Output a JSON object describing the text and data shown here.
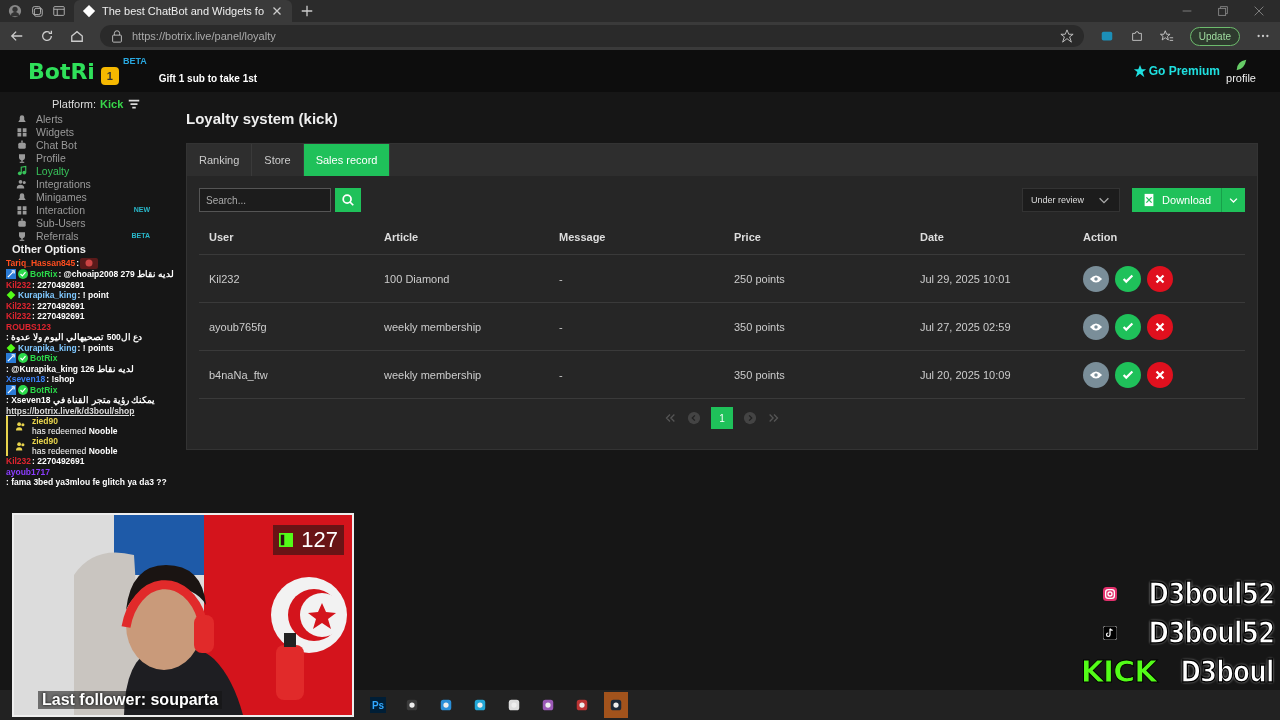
{
  "browser": {
    "tabs": [
      {
        "title": "The best ChatBot and Widgets fo",
        "selected": true
      }
    ],
    "url": "https://botrix.live/panel/loyalty",
    "update_button": "Update"
  },
  "header": {
    "logo": "BotRi",
    "logo_badge": "1",
    "beta": "BETA",
    "gift_text": "Gift 1 sub to take 1st",
    "premium": "Go Premium",
    "profile": "profile"
  },
  "sidebar": {
    "platform_label": "Platform:",
    "platform": "Kick",
    "items": [
      {
        "label": "Alerts",
        "selected": false
      },
      {
        "label": "Widgets",
        "selected": false
      },
      {
        "label": "Chat Bot",
        "selected": false
      },
      {
        "label": "Profile",
        "selected": false
      },
      {
        "label": "Loyalty",
        "selected": true
      },
      {
        "label": "Integrations",
        "selected": false
      },
      {
        "label": "Minigames",
        "selected": false
      },
      {
        "label": "Interaction",
        "selected": false,
        "badge": "NEW"
      },
      {
        "label": "Sub-Users",
        "selected": false
      },
      {
        "label": "Referrals",
        "selected": false,
        "badge": "BETA"
      }
    ],
    "section": "Other Options"
  },
  "chat_overlay": {
    "messages": [
      {
        "kind": "emote",
        "user": "Tariq_Hassan845",
        "color": "#ff4d1f",
        "text": ":"
      },
      {
        "kind": "bot",
        "user": "BotRix",
        "color": "#2bd94a",
        "text": ": @choaip2008 279 لديه نقاط"
      },
      {
        "kind": "plain",
        "user": "Kil232",
        "color": "#e0242f",
        "text": ": 2270492691"
      },
      {
        "kind": "sub",
        "user": "Kurapika_king",
        "color": "#7fc8ff",
        "text": ": ! point"
      },
      {
        "kind": "plain",
        "user": "Kil232",
        "color": "#e0242f",
        "text": ": 2270492691"
      },
      {
        "kind": "plain",
        "user": "Kil232",
        "color": "#e0242f",
        "text": ": 2270492691"
      },
      {
        "kind": "plain",
        "user": "ROUBS123",
        "color": "#e0242f",
        "text": ": دع ال500 تصحيهالي اليوم ولا عدوة"
      },
      {
        "kind": "sub",
        "user": "Kurapika_king",
        "color": "#7fc8ff",
        "text": ": ! points"
      },
      {
        "kind": "bot",
        "user": "BotRix",
        "color": "#2bd94a",
        "text": ": @Kurapika_king 126 لديه نقاط"
      },
      {
        "kind": "plain",
        "user": "Xseven18",
        "color": "#3b82f6",
        "text": ": !shop"
      },
      {
        "kind": "bot",
        "user": "BotRix",
        "color": "#2bd94a",
        "text": ": Xseven18 يمكنك رؤية متجر القناة في",
        "link": "https://botrix.live/k/d3boul/shop"
      },
      {
        "kind": "redeem",
        "user": "zied90",
        "color": "#e8d44d",
        "text": "has redeemed **Nooble**"
      },
      {
        "kind": "redeem",
        "user": "zied90",
        "color": "#e8d44d",
        "text": "has redeemed **Nooble**"
      },
      {
        "kind": "plain",
        "user": "Kil232",
        "color": "#e0242f",
        "text": ": 2270492691"
      },
      {
        "kind": "plain",
        "user": "ayoub1717",
        "color": "#8b3dff",
        "text": ": fama 3bed ya3mlou fe glitch ya da3 ??"
      }
    ]
  },
  "main": {
    "title": "Loyalty system (kick)",
    "tabs": [
      {
        "label": "Ranking",
        "selected": false
      },
      {
        "label": "Store",
        "selected": false
      },
      {
        "label": "Sales record",
        "selected": true
      }
    ],
    "search": {
      "placeholder": "Search..."
    },
    "filter": "Under review",
    "download": "Download",
    "table": {
      "columns": [
        "User",
        "Article",
        "Message",
        "Price",
        "Date",
        "Action"
      ],
      "rows": [
        {
          "user": "Kil232",
          "article": "100 Diamond",
          "message": "-",
          "price": "250 points",
          "date": "Jul 29, 2025 10:01"
        },
        {
          "user": "ayoub765fg",
          "article": "weekly membership",
          "message": "-",
          "price": "350 points",
          "date": "Jul 27, 2025 02:59"
        },
        {
          "user": "b4naNa_ftw",
          "article": "weekly membership",
          "message": "-",
          "price": "350 points",
          "date": "Jul 20, 2025 10:09"
        }
      ]
    },
    "pagination": [
      {
        "label": "1",
        "selected": true
      }
    ]
  },
  "webcam": {
    "kind": "picture",
    "viewers": "127",
    "last_follower": "Last follower: souparta"
  },
  "taskbar": {
    "apps": [
      {
        "kind": "ps",
        "label": "Ps",
        "selected": false
      },
      {
        "kind": "app",
        "selected": false
      },
      {
        "kind": "app",
        "selected": false
      },
      {
        "kind": "app",
        "selected": false
      },
      {
        "kind": "app",
        "selected": false
      },
      {
        "kind": "app",
        "selected": false
      },
      {
        "kind": "app",
        "selected": false
      },
      {
        "kind": "app",
        "selected": true
      }
    ]
  },
  "socials": [
    {
      "kind": "instagram",
      "handle": "D3boul52"
    },
    {
      "kind": "tiktok",
      "handle": "D3boul52"
    },
    {
      "kind": "kick",
      "label": "KICK",
      "handle": "D3boul"
    }
  ]
}
